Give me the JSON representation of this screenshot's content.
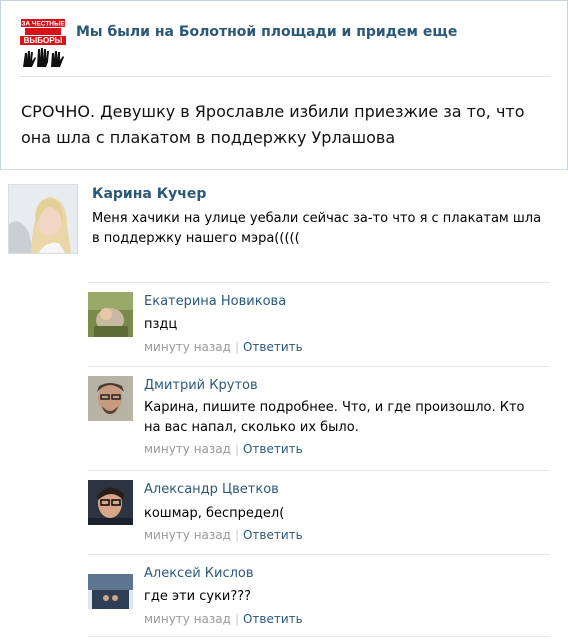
{
  "group": {
    "logo_text": "МИТИНГ ЗА ЧЕСТНЫЕ ВЫБОРЫ",
    "name": "Мы были на Болотной площади и придем еще"
  },
  "post": {
    "text": "СРОЧНО. Девушку в Ярославле избили приезжие за то, что она шла с плакатом в поддержку Урлашова"
  },
  "main_comment": {
    "author": "Карина Кучер",
    "text": "Меня хачики на улице уебали сейчас за-то что я с плакатам шла в поддержку нашего мэра((((("
  },
  "replies": [
    {
      "author": "Екатерина Новикова",
      "text": "пздц",
      "time": "минуту назад",
      "sep": "|",
      "reply": "Ответить"
    },
    {
      "author": "Дмитрий Крутов",
      "text": "Карина, пишите подробнее. Что, и где произошло. Кто на вас напал, сколько их было.",
      "time": "минуту назад",
      "sep": "|",
      "reply": "Ответить"
    },
    {
      "author": "Александр Цветков",
      "text": "кошмар, беспредел(",
      "time": "минуту назад",
      "sep": "|",
      "reply": "Ответить"
    },
    {
      "author": "Алексей Кислов",
      "text": "где эти суки???",
      "time": "минуту назад",
      "sep": "|",
      "reply": "Ответить"
    }
  ],
  "colors": {
    "link": "#2b587a",
    "meta": "#999999",
    "logo_red": "#d8121a"
  }
}
